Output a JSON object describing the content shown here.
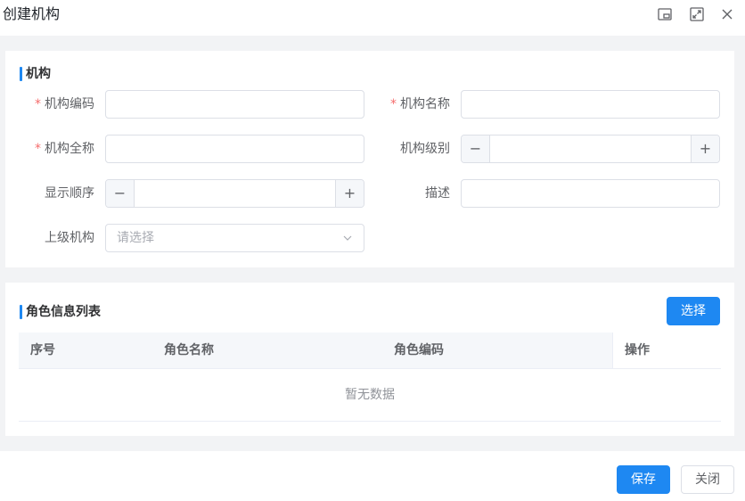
{
  "dialog": {
    "title": "创建机构",
    "icons": [
      "restore-window-icon",
      "fullscreen-icon",
      "close-icon"
    ]
  },
  "basic_section": {
    "title": "机构",
    "fields": {
      "org_code": {
        "label": "机构编码",
        "required": true,
        "value": ""
      },
      "org_name": {
        "label": "机构名称",
        "required": true,
        "value": ""
      },
      "org_full_name": {
        "label": "机构全称",
        "required": true,
        "value": ""
      },
      "org_level": {
        "label": "机构级别",
        "value": "",
        "minus": "−",
        "plus": "+"
      },
      "display_order": {
        "label": "显示顺序",
        "value": "",
        "minus": "−",
        "plus": "+"
      },
      "description": {
        "label": "描述",
        "value": ""
      },
      "parent_org": {
        "label": "上级机构",
        "placeholder": "请选择",
        "value": ""
      }
    }
  },
  "roles_section": {
    "title": "角色信息列表",
    "select_button": "选择",
    "table": {
      "columns": [
        "序号",
        "角色名称",
        "角色编码",
        "操作"
      ],
      "rows": [],
      "empty_text": "暂无数据"
    }
  },
  "footer": {
    "save_button": "保存",
    "close_button": "关闭"
  },
  "colors": {
    "primary": "#1e88f2",
    "required_star": "#f56c6c",
    "body_background": "#f2f3f5"
  }
}
